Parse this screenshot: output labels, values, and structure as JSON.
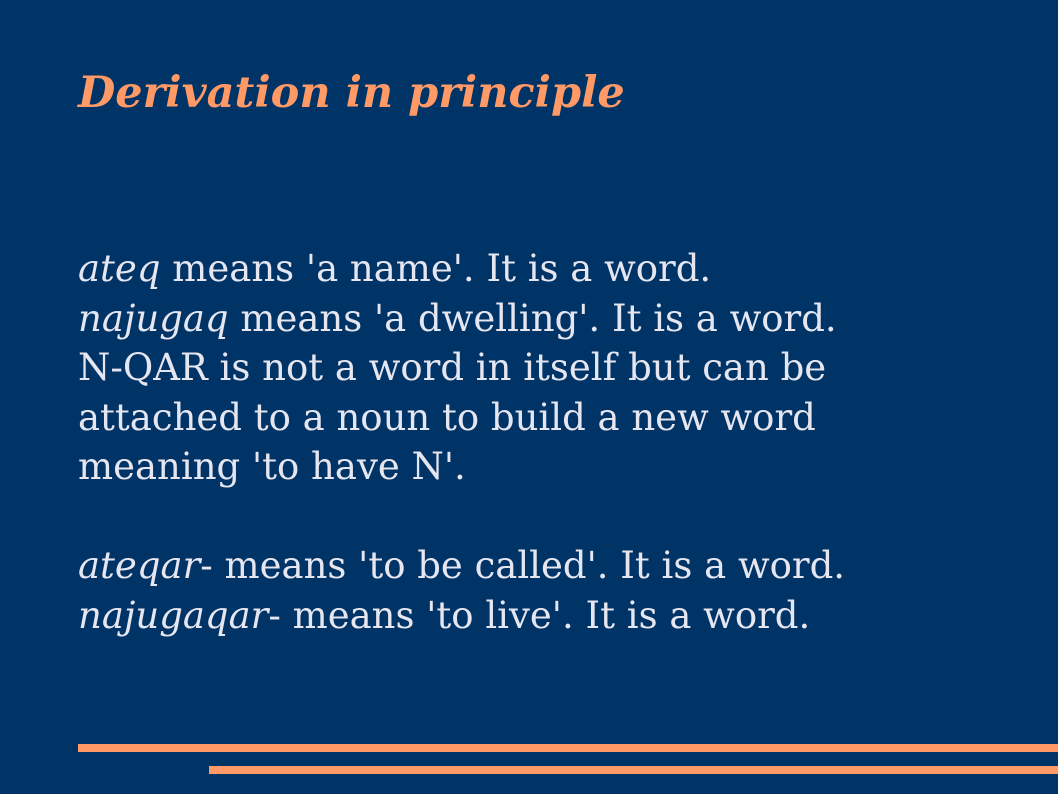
{
  "slide": {
    "title": "Derivation in principle",
    "lines": [
      {
        "term": "ateq",
        "text": " means 'a name'. It is a word."
      },
      {
        "term": "najugaq",
        "text": " means 'a dwelling'. It is a word."
      },
      {
        "text": "N-QAR is not a word in itself but can be"
      },
      {
        "text": "attached to a noun to build a new word"
      },
      {
        "text": "meaning 'to have N'."
      },
      {
        "term": "ateqar",
        "text": "- means 'to be called'. It is a word."
      },
      {
        "term": "najugaqar",
        "text": "- means 'to live'. It is a word."
      }
    ]
  },
  "colors": {
    "background": "#003366",
    "accent": "#FF9966",
    "text": "#E6E6F0"
  }
}
